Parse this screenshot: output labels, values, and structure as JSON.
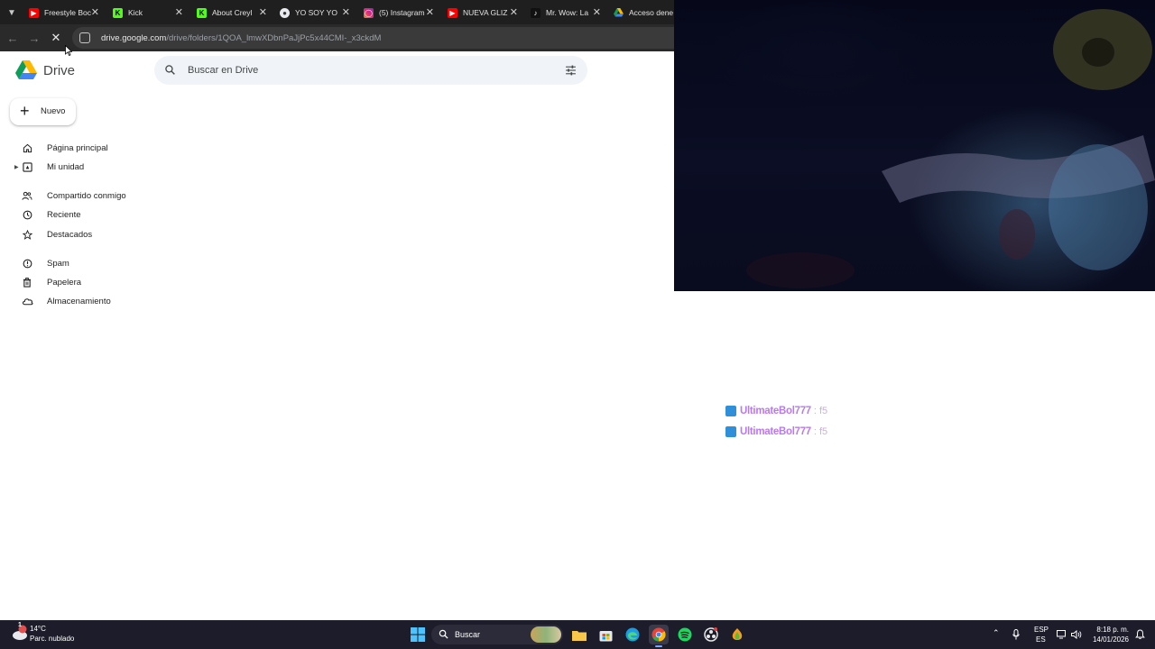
{
  "browser": {
    "tabs": [
      {
        "title": "Freestyle Boc",
        "icon": "youtube-icon",
        "color": "#ff0000"
      },
      {
        "title": "Kick",
        "icon": "kick-icon",
        "color": "#53fc18"
      },
      {
        "title": "About Creyl",
        "icon": "kick-icon",
        "color": "#53fc18"
      },
      {
        "title": "YO SOY YO",
        "icon": "circle-icon",
        "color": "#e8eaed"
      },
      {
        "title": "(5) Instagram",
        "icon": "instagram-icon",
        "color": "#e1306c"
      },
      {
        "title": "NUEVA GLIZ",
        "icon": "youtube-icon",
        "color": "#ff0000"
      },
      {
        "title": "Mr. Wow: La",
        "icon": "tiktok-icon",
        "color": "#111111"
      },
      {
        "title": "Acceso dene",
        "icon": "drive-icon",
        "color": "#1fa463"
      }
    ],
    "url_host": "drive.google.com",
    "url_path": "/drive/folders/1QOA_lmwXDbnPaJjPc5x44CMI-_x3ckdM"
  },
  "drive": {
    "app_name": "Drive",
    "search_placeholder": "Buscar en Drive",
    "new_button": "Nuevo",
    "nav": [
      {
        "label": "Página principal",
        "icon": "home-icon"
      },
      {
        "label": "Mi unidad",
        "icon": "my-drive-icon"
      },
      {
        "label": "Compartido conmigo",
        "icon": "shared-icon"
      },
      {
        "label": "Reciente",
        "icon": "clock-icon"
      },
      {
        "label": "Destacados",
        "icon": "star-icon"
      },
      {
        "label": "Spam",
        "icon": "spam-icon"
      },
      {
        "label": "Papelera",
        "icon": "trash-icon"
      },
      {
        "label": "Almacenamiento",
        "icon": "cloud-icon"
      }
    ]
  },
  "chat": [
    {
      "user": "UltimateBol777",
      "message": ": f5"
    },
    {
      "user": "UltimateBol777",
      "message": ": f5"
    }
  ],
  "taskbar": {
    "temperature": "14°C",
    "weather": "Parc. nublado",
    "weather_badge": "1",
    "search": "Buscar",
    "lang_top": "ESP",
    "lang_bottom": "ES",
    "time": "8:18 p. m.",
    "date": "14/01/2026"
  }
}
